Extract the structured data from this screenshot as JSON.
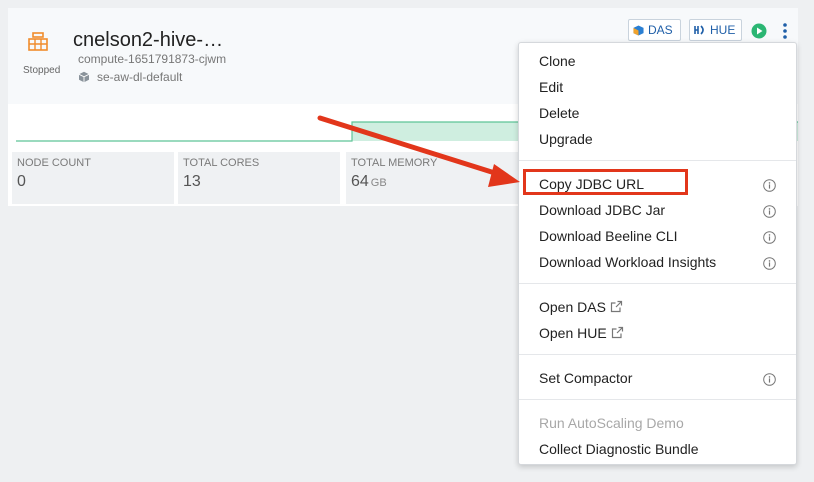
{
  "card": {
    "status": "Stopped",
    "title": "cnelson2-hive-…",
    "subtitle": "compute-1651791873-cjwm",
    "environment": "se-aw-dl-default",
    "buttons": {
      "das": "DAS",
      "hue": "HUE"
    },
    "stats": [
      {
        "label": "NODE COUNT",
        "value": "0",
        "unit": ""
      },
      {
        "label": "TOTAL CORES",
        "value": "13",
        "unit": ""
      },
      {
        "label": "TOTAL MEMORY",
        "value": "64",
        "unit": "GB"
      }
    ]
  },
  "menu": {
    "clone": "Clone",
    "edit": "Edit",
    "delete": "Delete",
    "upgrade": "Upgrade",
    "copy_jdbc_url": "Copy JDBC URL",
    "download_jdbc_jar": "Download JDBC Jar",
    "download_beeline_cli": "Download Beeline CLI",
    "download_workload_insights": "Download Workload Insights",
    "open_das": "Open DAS",
    "open_hue": "Open HUE",
    "set_compactor": "Set Compactor",
    "run_autoscaling_demo": "Run AutoScaling Demo",
    "collect_diagnostic_bundle": "Collect Diagnostic Bundle"
  },
  "colors": {
    "accent": "#1f5fa8",
    "status_icon": "#f08c2c",
    "play": "#2bb673",
    "highlight": "#e2361b",
    "chart_line": "#5ec497",
    "chart_fill": "#cfeee0"
  }
}
